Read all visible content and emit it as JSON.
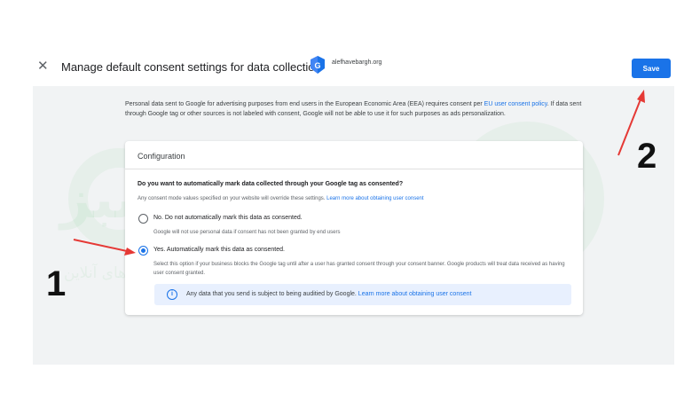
{
  "dialog": {
    "close_symbol": "✕",
    "title": "Manage default consent settings for data collection",
    "account": "alefhavebargh.org",
    "gtag_letter": "G",
    "save_label": "Save"
  },
  "intro": {
    "text_before": "Personal data sent to Google for advertising purposes from end users in the European Economic Area (EEA) requires consent per ",
    "link": "EU user consent policy",
    "text_after": ". If data sent through Google tag or other sources is not labeled with consent, Google will not be able to use it for such purposes as ads personalization."
  },
  "config": {
    "title": "Configuration",
    "question": "Do you want to automatically mark data collected through your Google tag as consented?",
    "help_before": "Any consent mode values specified on your website will override these settings. ",
    "help_link": "Learn more about obtaining user consent",
    "options": [
      {
        "label": "No. Do not automatically mark this data as consented.",
        "description": "Google will not use personal data if consent has not been granted by end users",
        "selected": false
      },
      {
        "label": "Yes. Automatically mark this data as consented.",
        "description": "Select this option if your business blocks the Google tag until after a user has granted consent through your consent banner. Google products will treat data received as having user consent granted.",
        "selected": true
      }
    ],
    "info_before": "Any data that you send is subject to being auditied by Google. ",
    "info_link": "Learn more about obtaining user consent",
    "info_icon": "i"
  },
  "annotations": {
    "step1": "1",
    "step2": "2",
    "arrow_color": "#e53935"
  },
  "watermark": {
    "main": "طراحسبز",
    "sub": "دنیای سبز کسب و کار های آنلاین"
  },
  "colors": {
    "accent": "#1a73e8",
    "content_bg": "#f1f3f4"
  }
}
